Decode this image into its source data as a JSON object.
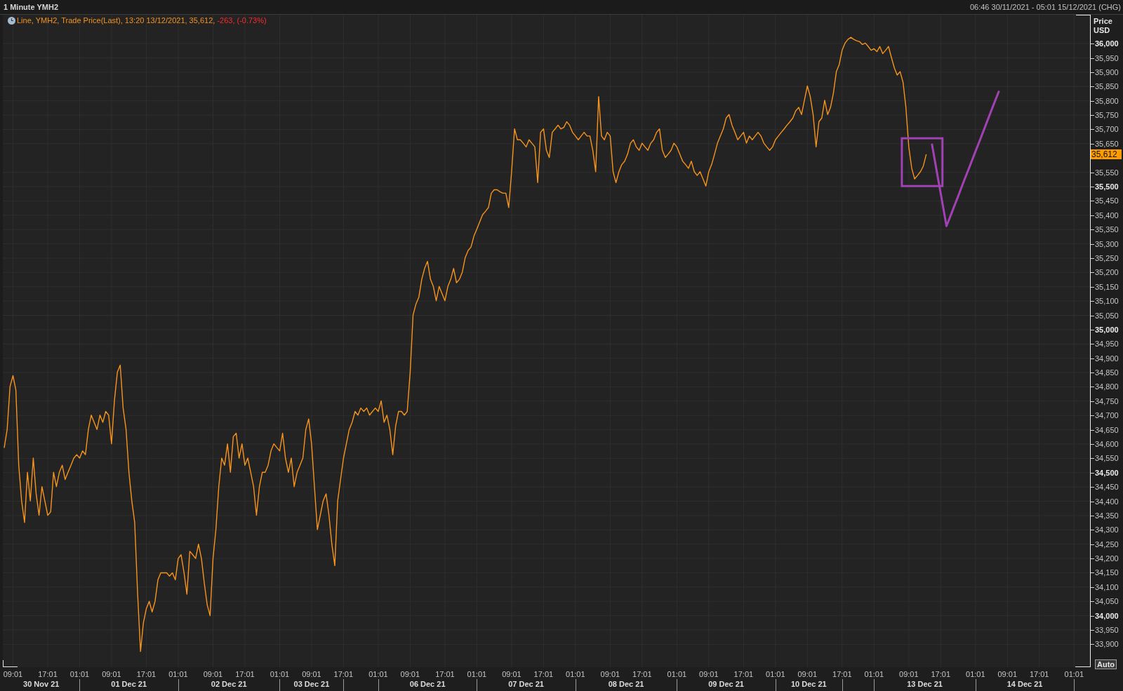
{
  "header": {
    "title": "1 Minute YMH2",
    "range": "06:46 30/11/2021 - 05:01 15/12/2021 (CHG)"
  },
  "chart": {
    "legend": {
      "text": "Line, YMH2, Trade Price(Last), 13:20 13/12/2021, 35,612,",
      "change": "-263, (-0.73%)",
      "change_negative": true
    },
    "axis_unit": "USD",
    "auto_button": "Auto",
    "last_price": {
      "label": "35,612",
      "color": "#ff9c00"
    },
    "date_labels": [
      "30 Nov 21",
      "01 Dec 21",
      "02 Dec 21",
      "03 Dec 21",
      "06 Dec 21",
      "07 Dec 21",
      "08 Dec 21",
      "09 Dec 21",
      "10 Dec 21",
      "13 Dec 21",
      "14 Dec 21"
    ],
    "drawings": [
      {
        "kind": "rectangle",
        "color": "#a142b4"
      }
    ],
    "chart_data": {
      "type": "line",
      "ylabel": "Price",
      "grid": true,
      "ylim": [
        33820,
        36101
      ],
      "categories": [
        null,
        null,
        null,
        "09:01",
        null,
        null,
        null,
        null,
        null,
        null,
        null,
        null,
        null,
        null,
        null,
        "17:01",
        null,
        null,
        null,
        null,
        null,
        null,
        null,
        null,
        null,
        null,
        "01:01",
        null,
        null,
        null,
        null,
        null,
        null,
        null,
        null,
        null,
        null,
        "09:01",
        null,
        null,
        null,
        null,
        null,
        null,
        null,
        null,
        null,
        null,
        null,
        "17:01",
        null,
        null,
        null,
        null,
        null,
        null,
        null,
        null,
        null,
        null,
        "01:01",
        null,
        null,
        null,
        null,
        null,
        null,
        null,
        null,
        null,
        null,
        null,
        "09:01",
        null,
        null,
        null,
        null,
        null,
        null,
        null,
        null,
        null,
        null,
        "17:01",
        null,
        null,
        null,
        null,
        null,
        null,
        null,
        null,
        null,
        null,
        null,
        "01:01",
        null,
        null,
        null,
        null,
        null,
        null,
        null,
        null,
        null,
        null,
        "09:01",
        null,
        null,
        null,
        null,
        null,
        null,
        null,
        null,
        null,
        null,
        "17:01",
        null,
        null,
        null,
        null,
        null,
        null,
        null,
        null,
        null,
        null,
        null,
        "01:01",
        null,
        null,
        null,
        null,
        null,
        null,
        null,
        null,
        null,
        null,
        "09:01",
        null,
        null,
        null,
        null,
        null,
        null,
        null,
        null,
        null,
        null,
        null,
        "17:01",
        null,
        null,
        null,
        null,
        null,
        null,
        null,
        null,
        null,
        null,
        "01:01",
        null,
        null,
        null,
        null,
        null,
        null,
        null,
        null,
        null,
        null,
        null,
        "09:01",
        null,
        null,
        null,
        null,
        null,
        null,
        null,
        null,
        null,
        null,
        "17:01",
        null,
        null,
        null,
        null,
        null,
        null,
        null,
        null,
        null,
        null,
        "01:01",
        null,
        null,
        null,
        null,
        null,
        null,
        null,
        null,
        null,
        null,
        null,
        "09:01",
        null,
        null,
        null,
        null,
        null,
        null,
        null,
        null,
        null,
        null,
        "17:01",
        null,
        null,
        null,
        null,
        null,
        null,
        null,
        null,
        null,
        null,
        null,
        "01:01",
        null,
        null,
        null,
        null,
        null,
        null,
        null,
        null,
        null,
        null,
        "09:01",
        null,
        null,
        null,
        null,
        null,
        null,
        null,
        null,
        null,
        null,
        null,
        "17:01",
        null,
        null,
        null,
        null,
        null,
        null,
        null,
        null,
        null,
        null,
        "01:01",
        null,
        null,
        null,
        null,
        null,
        null,
        null,
        null,
        null,
        null,
        "09:01",
        null,
        null,
        null,
        null,
        null,
        null,
        null,
        null,
        null,
        null,
        null,
        "17:01",
        null,
        null,
        null,
        null,
        null,
        null,
        null,
        null,
        null,
        null,
        "01:01",
        null,
        null,
        null,
        null,
        null,
        null,
        null,
        null,
        null,
        null,
        null,
        "09:01",
        null,
        null,
        null,
        null,
        null,
        null,
        null,
        null,
        null,
        null,
        "17:01",
        null,
        null,
        null,
        null,
        null,
        null,
        null,
        null,
        null,
        null,
        null,
        "01:01",
        null,
        null,
        null,
        null,
        null,
        null,
        null,
        null,
        null,
        null,
        "09:01",
        null,
        null,
        null,
        null,
        null,
        null,
        null,
        null,
        null,
        null,
        "17:01",
        null,
        null,
        null,
        null,
        null,
        null,
        null,
        null,
        null,
        null,
        null,
        "01:01",
        null,
        null,
        null,
        null,
        null
      ],
      "yticks": [
        {
          "value": 33900,
          "label": "33,900"
        },
        {
          "value": 33950,
          "label": "33,950"
        },
        {
          "value": 34000,
          "label": "34,000"
        },
        {
          "value": 34050,
          "label": "34,050"
        },
        {
          "value": 34100,
          "label": "34,100"
        },
        {
          "value": 34150,
          "label": "34,150"
        },
        {
          "value": 34200,
          "label": "34,200"
        },
        {
          "value": 34250,
          "label": "34,250"
        },
        {
          "value": 34300,
          "label": "34,300"
        },
        {
          "value": 34350,
          "label": "34,350"
        },
        {
          "value": 34400,
          "label": "34,400"
        },
        {
          "value": 34450,
          "label": "34,450"
        },
        {
          "value": 34500,
          "label": "34,500"
        },
        {
          "value": 34550,
          "label": "34,550"
        },
        {
          "value": 34600,
          "label": "34,600"
        },
        {
          "value": 34650,
          "label": "34,650"
        },
        {
          "value": 34700,
          "label": "34,700"
        },
        {
          "value": 34750,
          "label": "34,750"
        },
        {
          "value": 34800,
          "label": "34,800"
        },
        {
          "value": 34850,
          "label": "34,850"
        },
        {
          "value": 34900,
          "label": "34,900"
        },
        {
          "value": 34950,
          "label": "34,950"
        },
        {
          "value": 35000,
          "label": "35,000"
        },
        {
          "value": 35050,
          "label": "35,050"
        },
        {
          "value": 35100,
          "label": "35,100"
        },
        {
          "value": 35150,
          "label": "35,150"
        },
        {
          "value": 35200,
          "label": "35,200"
        },
        {
          "value": 35250,
          "label": "35,250"
        },
        {
          "value": 35300,
          "label": "35,300"
        },
        {
          "value": 35350,
          "label": "35,350"
        },
        {
          "value": 35400,
          "label": "35,400"
        },
        {
          "value": 35450,
          "label": "35,450"
        },
        {
          "value": 35500,
          "label": "35,500"
        },
        {
          "value": 35550,
          "label": "35,550"
        },
        {
          "value": 35650,
          "label": "35,650"
        },
        {
          "value": 35700,
          "label": "35,700"
        },
        {
          "value": 35750,
          "label": "35,750"
        },
        {
          "value": 35800,
          "label": "35,800"
        },
        {
          "value": 35850,
          "label": "35,850"
        },
        {
          "value": 35900,
          "label": "35,900"
        },
        {
          "value": 35950,
          "label": "35,950"
        },
        {
          "value": 36000,
          "label": "36,000"
        }
      ],
      "series": [
        {
          "color": "#f7941d",
          "values": [
            34588,
            34651,
            34801,
            34839,
            34789,
            34526,
            34401,
            34326,
            34501,
            34401,
            34551,
            34426,
            34351,
            34451,
            34401,
            34351,
            34363,
            34501,
            34451,
            34501,
            34526,
            34476,
            34501,
            34526,
            34551,
            34563,
            34551,
            34576,
            34563,
            34651,
            34701,
            34676,
            34651,
            34701,
            34676,
            34714,
            34701,
            34601,
            34751,
            34851,
            34876,
            34726,
            34651,
            34501,
            34401,
            34326,
            34075,
            33875,
            33975,
            34025,
            34050,
            34013,
            34050,
            34125,
            34150,
            34150,
            34150,
            34138,
            34150,
            34125,
            34200,
            34213,
            34150,
            34075,
            34225,
            34213,
            34200,
            34250,
            34200,
            34113,
            34038,
            34000,
            34200,
            34301,
            34451,
            34551,
            34526,
            34601,
            34501,
            34626,
            34638,
            34551,
            34601,
            34526,
            34551,
            34501,
            34451,
            34351,
            34451,
            34501,
            34501,
            34526,
            34576,
            34601,
            34588,
            34576,
            34638,
            34551,
            34501,
            34551,
            34451,
            34501,
            34526,
            34551,
            34651,
            34688,
            34601,
            34451,
            34301,
            34351,
            34401,
            34426,
            34351,
            34250,
            34175,
            34401,
            34476,
            34551,
            34601,
            34651,
            34676,
            34714,
            34701,
            34726,
            34714,
            34726,
            34701,
            34714,
            34726,
            34714,
            34751,
            34676,
            34701,
            34651,
            34563,
            34663,
            34714,
            34714,
            34701,
            34714,
            34851,
            35051,
            35089,
            35114,
            35176,
            35214,
            35239,
            35176,
            35151,
            35101,
            35151,
            35126,
            35101,
            35151,
            35176,
            35214,
            35164,
            35176,
            35201,
            35252,
            35277,
            35289,
            35327,
            35352,
            35377,
            35402,
            35414,
            35427,
            35477,
            35489,
            35489,
            35482,
            35477,
            35477,
            35427,
            35552,
            35702,
            35664,
            35664,
            35652,
            35639,
            35664,
            35652,
            35639,
            35514,
            35690,
            35702,
            35627,
            35602,
            35690,
            35702,
            35715,
            35702,
            35707,
            35727,
            35715,
            35690,
            35677,
            35664,
            35677,
            35690,
            35677,
            35677,
            35627,
            35552,
            35815,
            35677,
            35664,
            35690,
            35677,
            35552,
            35514,
            35552,
            35577,
            35589,
            35614,
            35652,
            35664,
            35639,
            35627,
            35652,
            35639,
            35627,
            35652,
            35664,
            35690,
            35702,
            35627,
            35602,
            35614,
            35627,
            35652,
            35639,
            35614,
            35589,
            35577,
            35564,
            35589,
            35552,
            35539,
            35552,
            35527,
            35502,
            35552,
            35577,
            35614,
            35652,
            35677,
            35702,
            35740,
            35752,
            35715,
            35690,
            35664,
            35677,
            35690,
            35652,
            35677,
            35664,
            35677,
            35690,
            35677,
            35652,
            35639,
            35627,
            35639,
            35664,
            35677,
            35690,
            35702,
            35715,
            35727,
            35740,
            35765,
            35777,
            35752,
            35802,
            35852,
            35815,
            35752,
            35639,
            35727,
            35740,
            35802,
            35752,
            35777,
            35827,
            35902,
            35927,
            35977,
            36002,
            36015,
            36022,
            36015,
            36010,
            36007,
            35997,
            36002,
            35990,
            35977,
            35982,
            35972,
            35990,
            35965,
            35977,
            35990,
            35952,
            35915,
            35890,
            35902,
            35865,
            35777,
            35639,
            35564,
            35527,
            35539,
            35552,
            35572,
            35612,
            null,
            null,
            null,
            null,
            null,
            null,
            null,
            null,
            null,
            null,
            null,
            null,
            null,
            null,
            null,
            null,
            null,
            null,
            null,
            null,
            null,
            null,
            null,
            null,
            null,
            null,
            null,
            null,
            null,
            null,
            null,
            null,
            null,
            null,
            null,
            null,
            null,
            null,
            null,
            null,
            null,
            null,
            null,
            null,
            null,
            null,
            null,
            null,
            null,
            null,
            null,
            null,
            null,
            null,
            null,
            null
          ]
        },
        {
          "color": "#a142b4",
          "values": [
            null,
            null,
            null,
            null,
            null,
            null,
            null,
            null,
            null,
            null,
            null,
            null,
            null,
            null,
            null,
            null,
            null,
            null,
            null,
            null,
            null,
            null,
            null,
            null,
            null,
            null,
            null,
            null,
            null,
            null,
            null,
            null,
            null,
            null,
            null,
            null,
            null,
            null,
            null,
            null,
            null,
            null,
            null,
            null,
            null,
            null,
            null,
            null,
            null,
            null,
            null,
            null,
            null,
            null,
            null,
            null,
            null,
            null,
            null,
            null,
            null,
            null,
            null,
            null,
            null,
            null,
            null,
            null,
            null,
            null,
            null,
            null,
            null,
            null,
            null,
            null,
            null,
            null,
            null,
            null,
            null,
            null,
            null,
            null,
            null,
            null,
            null,
            null,
            null,
            null,
            null,
            null,
            null,
            null,
            null,
            null,
            null,
            null,
            null,
            null,
            null,
            null,
            null,
            null,
            null,
            null,
            null,
            null,
            null,
            null,
            null,
            null,
            null,
            null,
            null,
            null,
            null,
            null,
            null,
            null,
            null,
            null,
            null,
            null,
            null,
            null,
            null,
            null,
            null,
            null,
            null,
            null,
            null,
            null,
            null,
            null,
            null,
            null,
            null,
            null,
            null,
            null,
            null,
            null,
            null,
            null,
            null,
            null,
            null,
            null,
            null,
            null,
            null,
            null,
            null,
            null,
            null,
            null,
            null,
            null,
            null,
            null,
            null,
            null,
            null,
            null,
            null,
            null,
            null,
            null,
            null,
            null,
            null,
            null,
            null,
            null,
            null,
            null,
            null,
            null,
            null,
            null,
            null,
            null,
            null,
            null,
            null,
            null,
            null,
            null,
            null,
            null,
            null,
            null,
            null,
            null,
            null,
            null,
            null,
            null,
            null,
            null,
            null,
            null,
            null,
            null,
            null,
            null,
            null,
            null,
            null,
            null,
            null,
            null,
            null,
            null,
            null,
            null,
            null,
            null,
            null,
            null,
            null,
            null,
            null,
            null,
            null,
            null,
            null,
            null,
            null,
            null,
            null,
            null,
            null,
            null,
            null,
            null,
            null,
            null,
            null,
            null,
            null,
            null,
            null,
            null,
            null,
            null,
            null,
            null,
            null,
            null,
            null,
            null,
            null,
            null,
            null,
            null,
            null,
            null,
            null,
            null,
            null,
            null,
            null,
            null,
            null,
            null,
            null,
            null,
            null,
            null,
            null,
            null,
            null,
            null,
            null,
            null,
            null,
            null,
            null,
            null,
            null,
            null,
            null,
            null,
            null,
            null,
            null,
            null,
            null,
            null,
            null,
            null,
            null,
            null,
            null,
            null,
            null,
            null,
            null,
            null,
            null,
            null,
            null,
            null,
            null,
            null,
            null,
            null,
            null,
            null,
            null,
            null,
            null,
            null,
            null,
            null,
            null,
            null,
            35647,
            35590,
            35533,
            35476,
            35419,
            35362,
            35388,
            35414,
            35440,
            35466,
            35493,
            35519,
            35545,
            35571,
            35597,
            35623,
            35649,
            35675,
            35701,
            35728,
            35754,
            35780,
            35806,
            35832,
            null,
            null,
            null,
            null,
            null,
            null,
            null,
            null,
            null,
            null,
            null,
            null,
            null,
            null,
            null,
            null,
            null,
            null,
            null,
            null,
            null,
            null,
            null,
            null,
            null,
            null,
            null,
            null,
            null,
            null,
            null
          ]
        }
      ]
    }
  }
}
